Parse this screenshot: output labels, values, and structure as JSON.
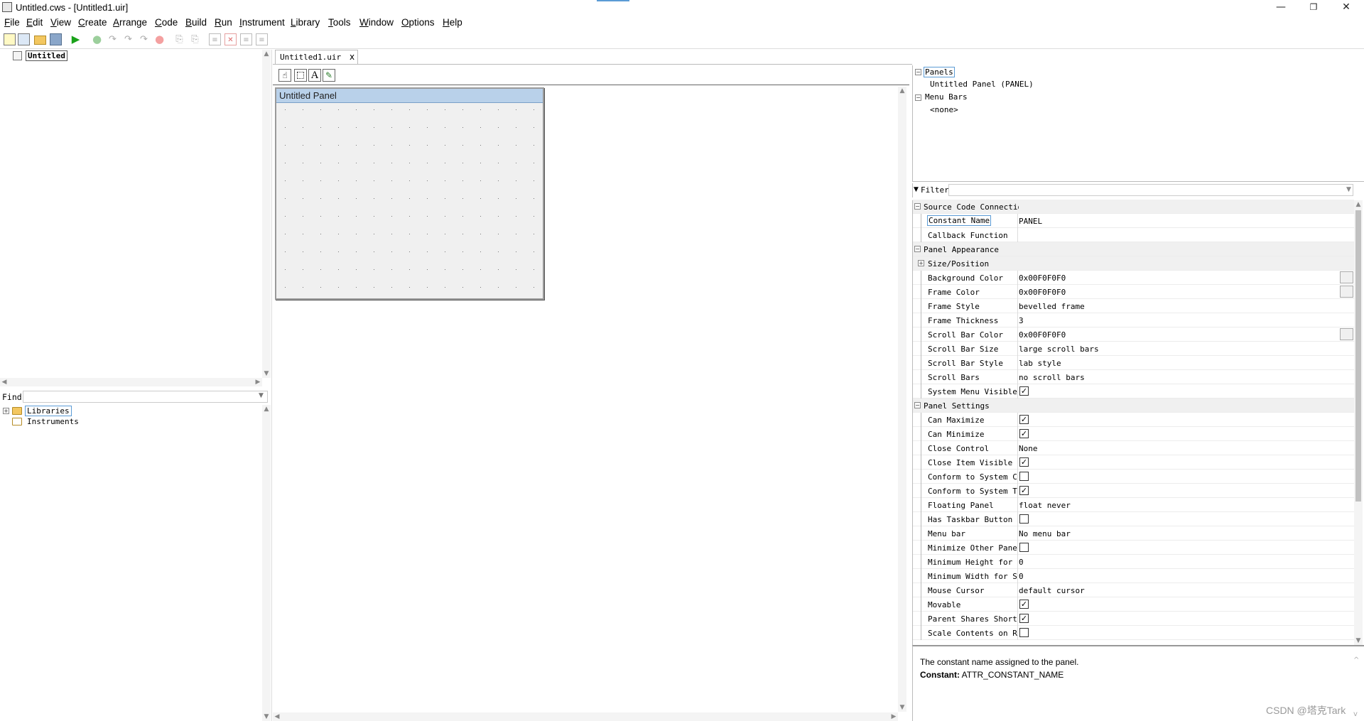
{
  "window": {
    "title": "Untitled.cws - [Untitled1.uir]",
    "minimize": "—",
    "restore": "❐",
    "close": "✕"
  },
  "menu": [
    {
      "label": "File",
      "u": "F",
      "rest": "ile"
    },
    {
      "label": "Edit",
      "u": "E",
      "rest": "dit"
    },
    {
      "label": "View",
      "u": "V",
      "rest": "iew"
    },
    {
      "label": "Create",
      "u": "C",
      "rest": "reate"
    },
    {
      "label": "Arrange",
      "u": "A",
      "rest": "rrange"
    },
    {
      "label": "Code",
      "u": "C",
      "rest": "ode"
    },
    {
      "label": "Build",
      "u": "B",
      "rest": "uild"
    },
    {
      "label": "Run",
      "u": "R",
      "rest": "un"
    },
    {
      "label": "Instrument",
      "u": "I",
      "rest": "nstrument"
    },
    {
      "label": "Library",
      "u": "L",
      "rest": "ibrary"
    },
    {
      "label": "Tools",
      "u": "T",
      "rest": "ools"
    },
    {
      "label": "Window",
      "u": "W",
      "rest": "indow"
    },
    {
      "label": "Options",
      "u": "O",
      "rest": "ptions"
    },
    {
      "label": "Help",
      "u": "H",
      "rest": "elp"
    }
  ],
  "project_tree": {
    "root": "Untitled"
  },
  "find": {
    "label": "Find",
    "value": ""
  },
  "library_tree": {
    "libraries": "Libraries",
    "instruments": "Instruments"
  },
  "editor": {
    "tab": "Untitled1.uir",
    "tab_close": "x",
    "panel_title": "Untitled Panel"
  },
  "outline": {
    "panels_label": "Panels",
    "panel_item": "Untitled Panel (PANEL)",
    "menubars_label": "Menu Bars",
    "menubar_item": "<none>"
  },
  "filter": {
    "label": "Filter",
    "value": ""
  },
  "properties": [
    {
      "type": "cat",
      "label": "Source Code Connection",
      "value": ""
    },
    {
      "type": "text",
      "label": "Constant Name",
      "value": "PANEL",
      "selected": true
    },
    {
      "type": "text",
      "label": "Callback Function",
      "value": ""
    },
    {
      "type": "cat",
      "label": "Panel Appearance",
      "value": ""
    },
    {
      "type": "sub",
      "label": "Size/Position",
      "value": ""
    },
    {
      "type": "color",
      "label": "Background Color",
      "value": "0x00F0F0F0"
    },
    {
      "type": "color",
      "label": "Frame Color",
      "value": "0x00F0F0F0"
    },
    {
      "type": "text",
      "label": "Frame Style",
      "value": "bevelled frame"
    },
    {
      "type": "text",
      "label": "Frame Thickness",
      "value": "3"
    },
    {
      "type": "color",
      "label": "Scroll Bar Color",
      "value": "0x00F0F0F0"
    },
    {
      "type": "text",
      "label": "Scroll Bar Size",
      "value": "large scroll bars"
    },
    {
      "type": "text",
      "label": "Scroll Bar Style",
      "value": "lab style"
    },
    {
      "type": "text",
      "label": "Scroll Bars",
      "value": "no scroll bars"
    },
    {
      "type": "check",
      "label": "System Menu Visible",
      "value": true
    },
    {
      "type": "cat",
      "label": "Panel Settings",
      "value": ""
    },
    {
      "type": "check",
      "label": "Can Maximize",
      "value": true
    },
    {
      "type": "check",
      "label": "Can Minimize",
      "value": true
    },
    {
      "type": "text",
      "label": "Close Control",
      "value": "None"
    },
    {
      "type": "check",
      "label": "Close Item Visible",
      "value": true
    },
    {
      "type": "check",
      "label": "Conform to System Colors",
      "value": false
    },
    {
      "type": "check",
      "label": "Conform to System Theme",
      "value": true
    },
    {
      "type": "text",
      "label": "Floating Panel",
      "value": "float never"
    },
    {
      "type": "check",
      "label": "Has Taskbar Button",
      "value": false
    },
    {
      "type": "text",
      "label": "Menu bar",
      "value": "No menu bar"
    },
    {
      "type": "check",
      "label": "Minimize Other Panels",
      "value": false
    },
    {
      "type": "text",
      "label": "Minimum Height for Scaling",
      "value": "0"
    },
    {
      "type": "text",
      "label": "Minimum Width for Scaling",
      "value": "0"
    },
    {
      "type": "text",
      "label": "Mouse Cursor",
      "value": "default cursor"
    },
    {
      "type": "check",
      "label": "Movable",
      "value": true
    },
    {
      "type": "check",
      "label": "Parent Shares Shortcut Keys",
      "value": true
    },
    {
      "type": "check",
      "label": "Scale Contents on Resize",
      "value": false
    }
  ],
  "help": {
    "description": "The constant name assigned to the panel.",
    "constant_label": "Constant:",
    "constant_value": "ATTR_CONSTANT_NAME"
  },
  "watermark": "CSDN @塔克Tark"
}
